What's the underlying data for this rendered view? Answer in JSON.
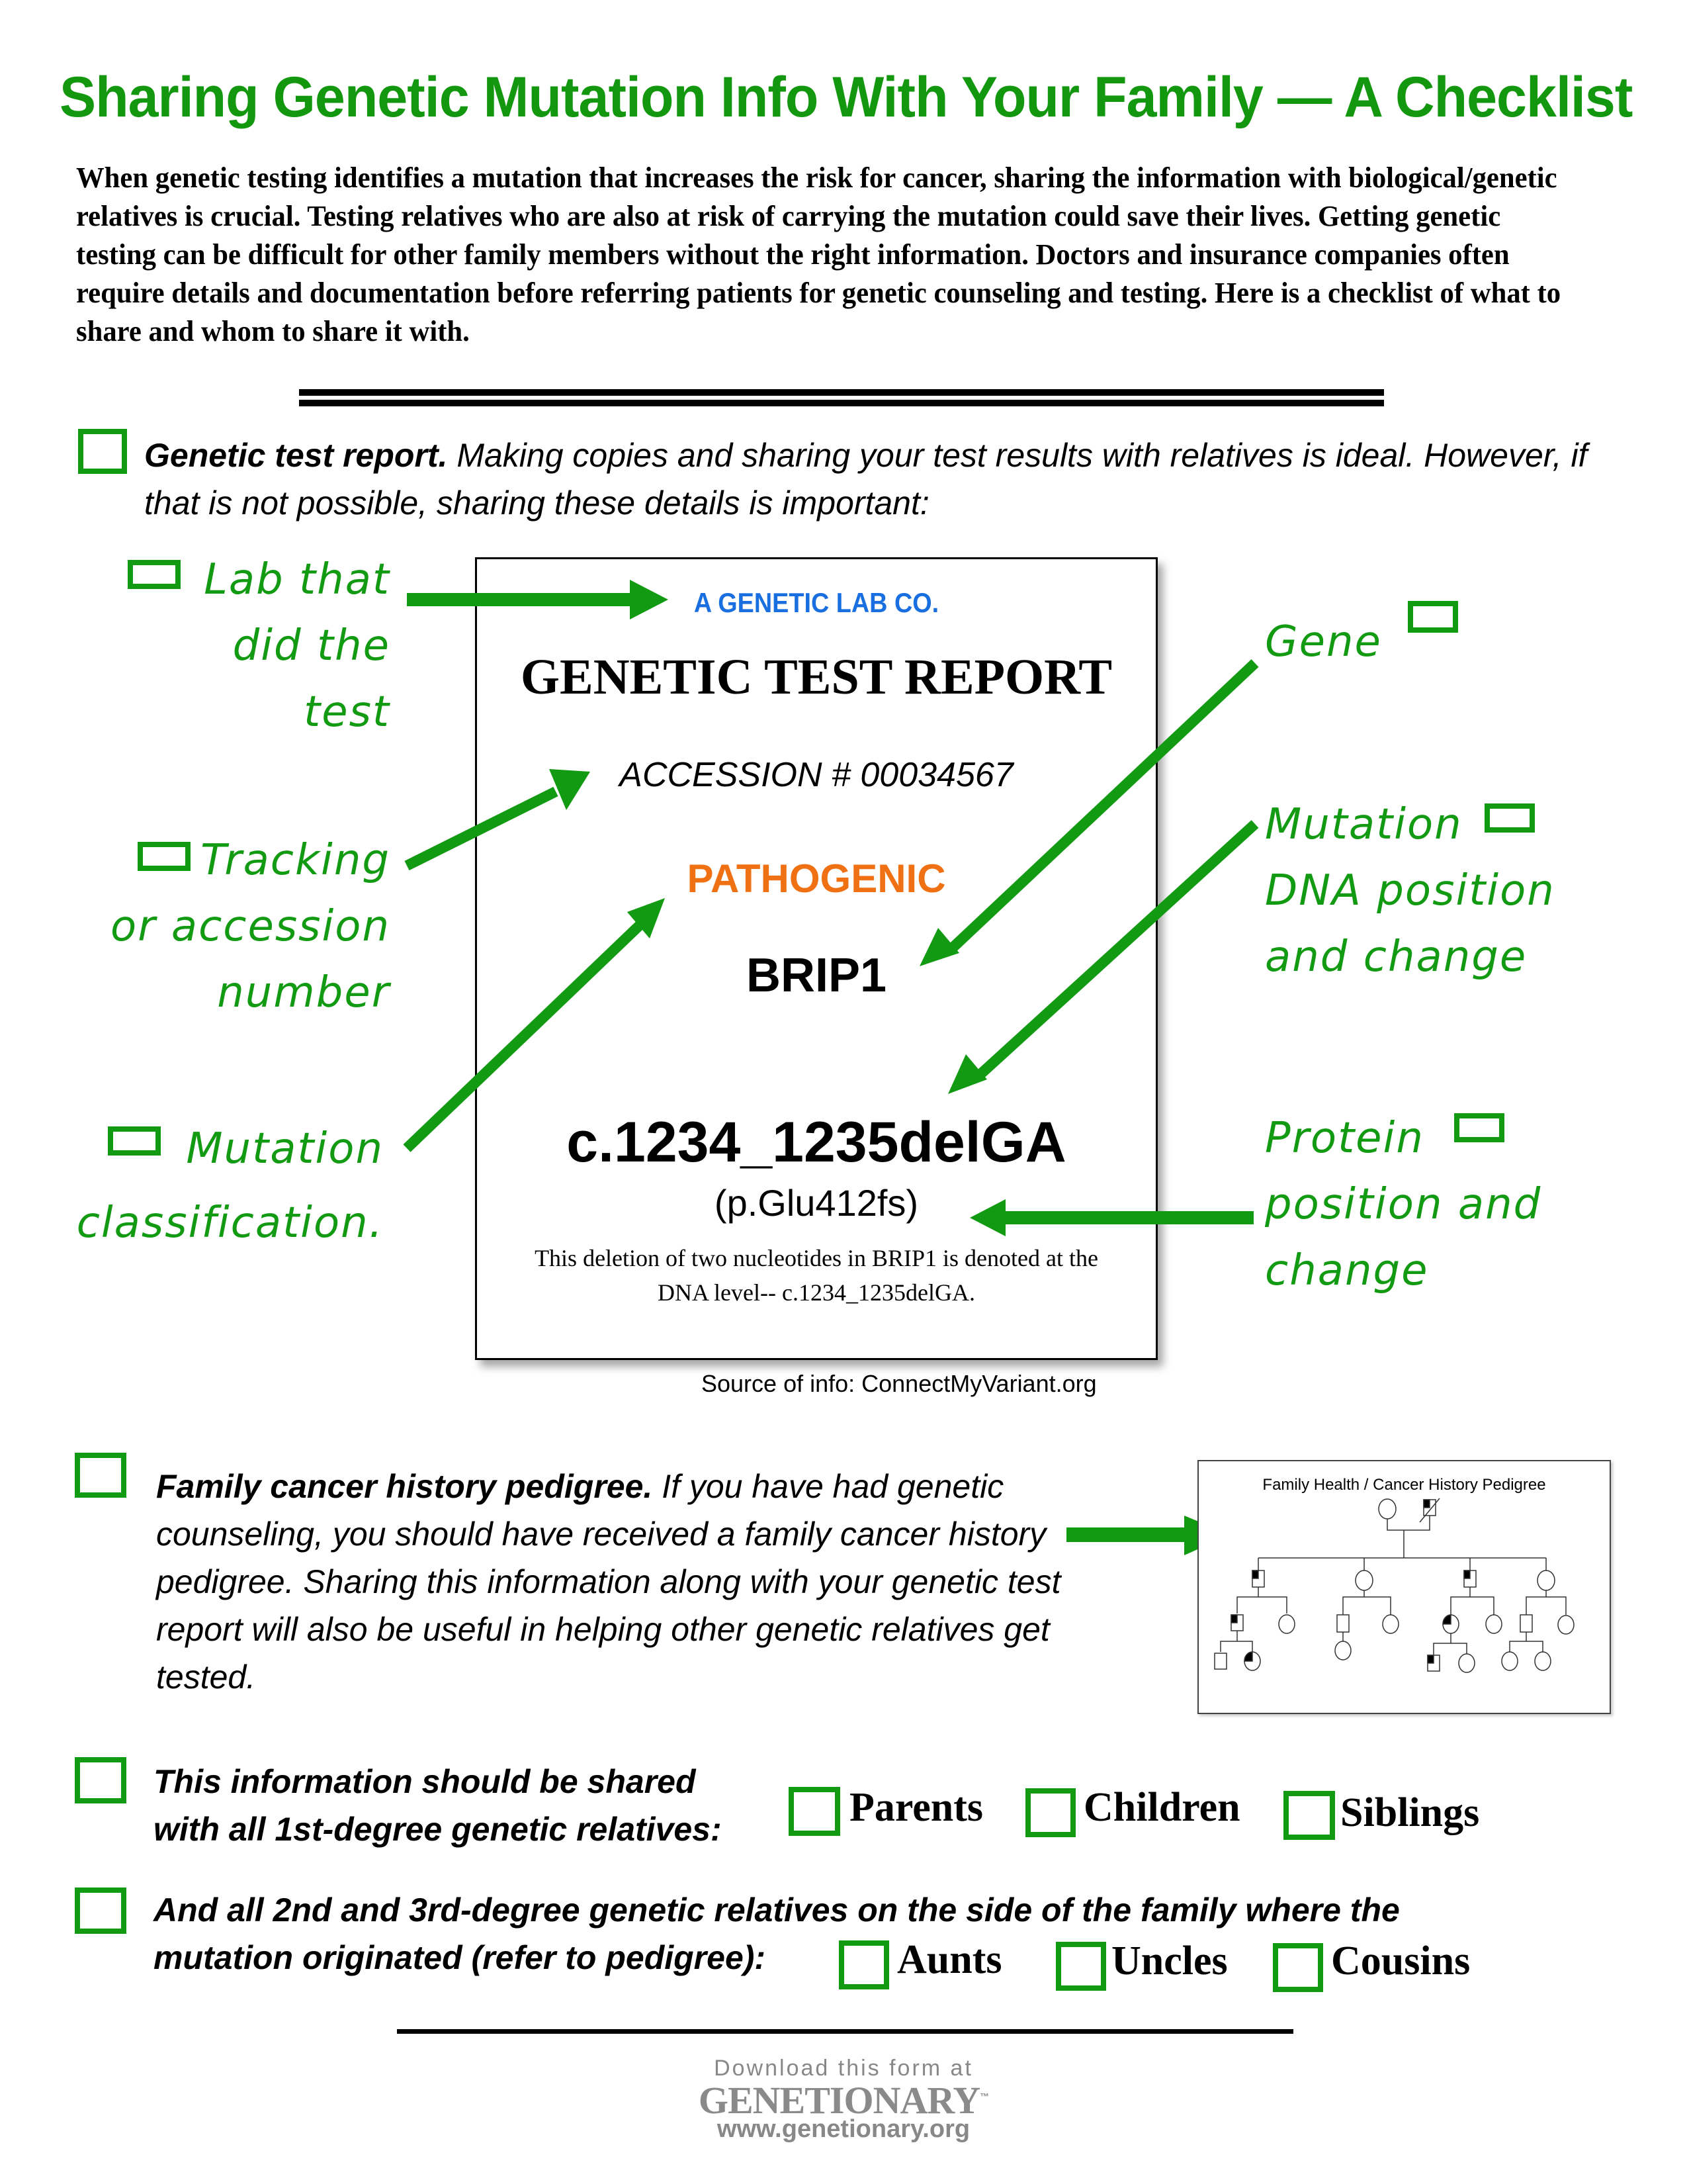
{
  "title": "Sharing Genetic Mutation Info With Your Family — A Checklist",
  "intro": "When genetic testing identifies a mutation that increases the risk for cancer, sharing the information with biological/genetic relatives is crucial. Testing relatives who are also at risk of carrying the mutation could save their lives.  Getting genetic testing can be difficult for other family members without the right information. Doctors and insurance companies often require details and documentation before referring patients for genetic counseling and testing. Here is a checklist of what to share and whom to share it with.",
  "section1": {
    "bold": "Genetic test report.",
    "text": " Making copies and sharing your test results with relatives is ideal. However, if that is not possible, sharing these details is important:"
  },
  "left_labels": {
    "lab": [
      "Lab that",
      "did the",
      "test"
    ],
    "tracking": [
      "Tracking",
      "or accession",
      "number"
    ],
    "classification": [
      "Mutation",
      "classification."
    ]
  },
  "right_labels": {
    "gene": "Gene",
    "mutation": [
      "Mutation",
      "DNA position",
      "and change"
    ],
    "protein": [
      "Protein",
      "position and",
      "change"
    ]
  },
  "report": {
    "lab_name": "A GENETIC LAB CO.",
    "title": "GENETIC TEST REPORT",
    "accession": "ACCESSION # 00034567",
    "classification": "PATHOGENIC",
    "gene": "BRIP1",
    "dna_change": "c.1234_1235delGA",
    "protein_change": "(p.Glu412fs)",
    "description": "This deletion of two nucleotides in BRIP1 is denoted at the DNA level-- c.1234_1235delGA."
  },
  "source": "Source of info: ConnectMyVariant.org",
  "section2": {
    "bold": "Family cancer history pedigree.",
    "text": " If you have had genetic counseling, you should have received a family cancer history pedigree. Sharing this information along with your genetic test report will also be useful in helping other genetic relatives get tested."
  },
  "pedigree": {
    "title": "Family Health / Cancer History Pedigree"
  },
  "section3": {
    "text_line1": "This information should be shared",
    "text_line2": "with all 1st-degree genetic relatives:",
    "relatives": [
      "Parents",
      "Children",
      "Siblings"
    ]
  },
  "section4": {
    "text_line1": "And all 2nd and 3rd-degree genetic relatives on the side of the family where the",
    "text_line2": "mutation originated (refer to pedigree):",
    "relatives": [
      "Aunts",
      "Uncles",
      "Cousins"
    ]
  },
  "footer": {
    "download": "Download this form at",
    "brand": "GENETIONARY",
    "tm": "™",
    "url": "www.genetionary.org"
  }
}
